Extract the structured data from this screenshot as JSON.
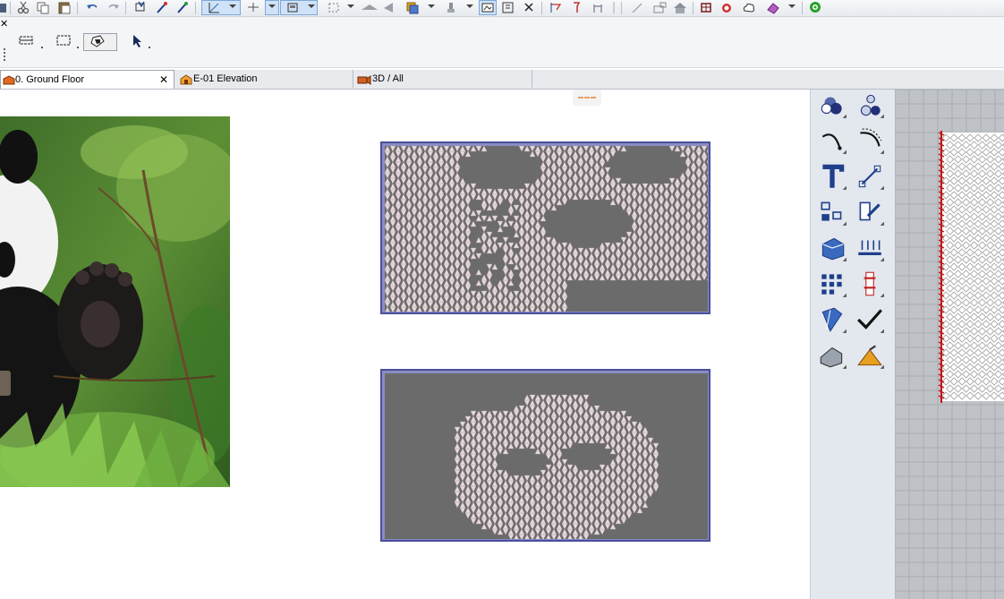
{
  "tabs": [
    {
      "label": "0. Ground Floor",
      "active": true,
      "icon": "floor-plan-icon",
      "closable": true
    },
    {
      "label": "E-01 Elevation",
      "active": false,
      "icon": "elevation-icon"
    },
    {
      "label": "3D / All",
      "active": false,
      "icon": "3d-camera-icon"
    }
  ],
  "toolbar_top_icons": [
    "cut-icon",
    "copy-icon",
    "paste-icon",
    "undo-icon",
    "redo-icon",
    "pick-up-parameters-icon",
    "inject-parameters-icon",
    "eyedropper-icon",
    "grid-snap-icon",
    "guide-line-icon",
    "snap-points-icon",
    "marquee-icon",
    "layer-icon",
    "elevation-marker-icon",
    "trace-icon",
    "render-icon",
    "renovation-icon",
    "section-icon",
    "3d-view-icon"
  ],
  "info_box_tools": [
    "polyline-geometry-icon",
    "rectangle-geometry-icon",
    "fill-geometry-icon",
    "arrow-tool-icon"
  ],
  "toolbox_tools": [
    [
      "object-icon",
      "lamp-icon"
    ],
    [
      "arc-icon",
      "spline-icon"
    ],
    [
      "text-icon",
      "dimension-icon"
    ],
    [
      "group-icon",
      "label-icon"
    ],
    [
      "roof-icon",
      "stair-icon"
    ],
    [
      "grid-icon",
      "column-icon"
    ],
    [
      "curtain-wall-icon",
      "check-icon"
    ],
    [
      "morph-icon",
      "shell-icon"
    ]
  ],
  "colors": {
    "panel_fill": "#6b6b6b",
    "panel_pattern": "#e8d9dc",
    "panel_border": "#4b4f9c",
    "toolbar_active": "#cfe2f7",
    "toolbox_bg": "#e3e7ee"
  }
}
